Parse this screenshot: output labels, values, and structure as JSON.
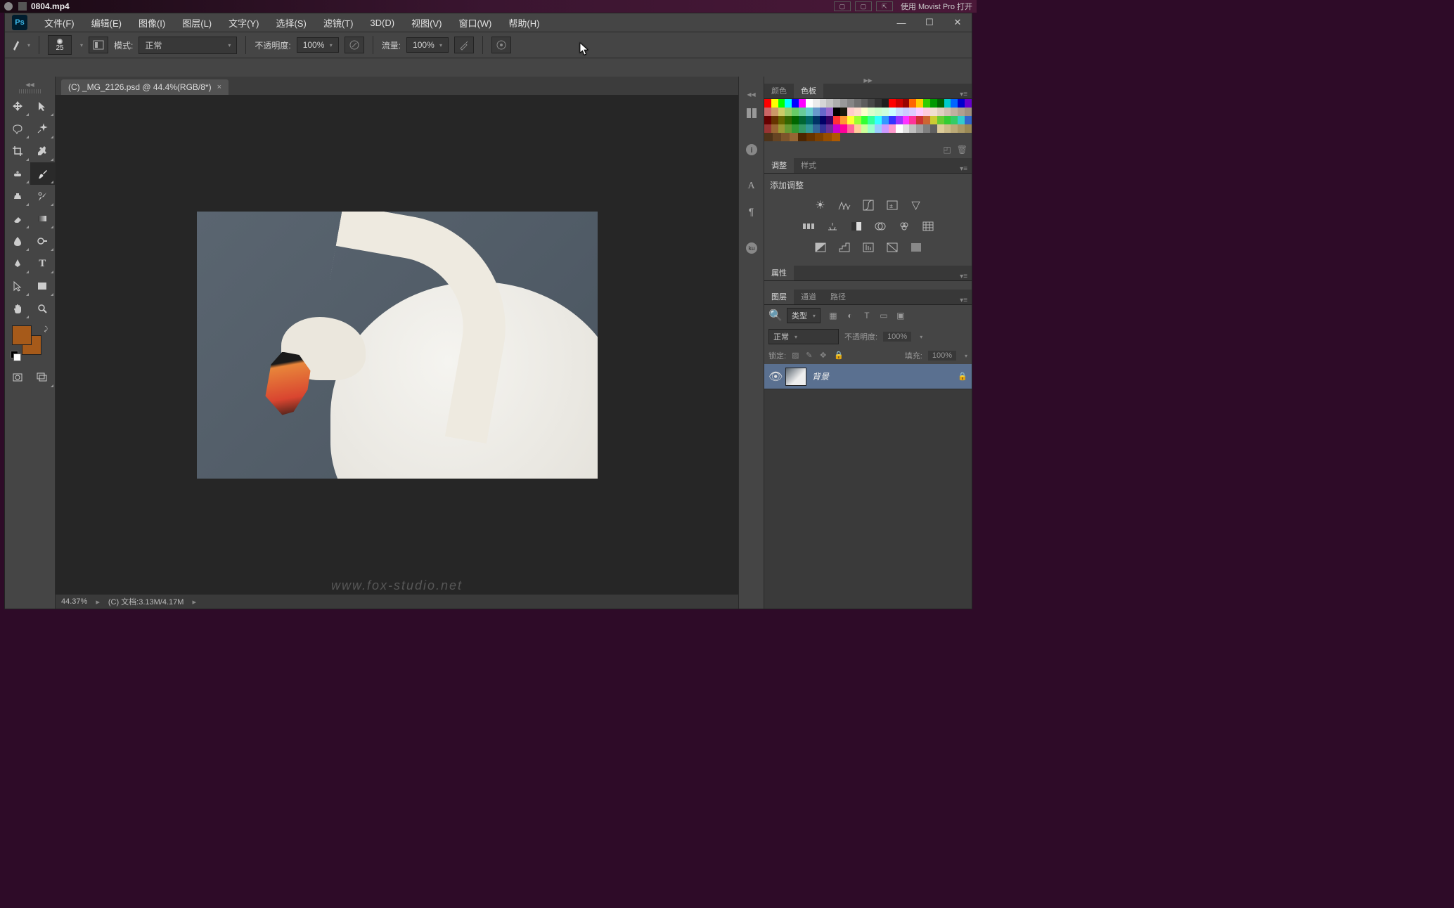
{
  "os": {
    "filename": "0804.mp4",
    "movist": "使用 Movist Pro 打开"
  },
  "window": {
    "logo": "Ps"
  },
  "menus": [
    "文件(F)",
    "编辑(E)",
    "图像(I)",
    "图层(L)",
    "文字(Y)",
    "选择(S)",
    "滤镜(T)",
    "3D(D)",
    "视图(V)",
    "窗口(W)",
    "帮助(H)"
  ],
  "options": {
    "brush_size": "25",
    "mode_label": "模式:",
    "mode_value": "正常",
    "opacity_label": "不透明度:",
    "opacity_value": "100%",
    "flow_label": "流量:",
    "flow_value": "100%"
  },
  "doc": {
    "tab": "(C) _MG_2126.psd @ 44.4%(RGB/8*)",
    "zoom": "44.37%",
    "docinfo": "(C) 文档:3.13M/4.17M",
    "watermark": "www.fox-studio.net"
  },
  "colors": {
    "fg": "#a65a1a",
    "bg": "#a65a1a"
  },
  "panels": {
    "color_tab": "颜色",
    "swatches_tab": "色板",
    "adjust_tab": "调整",
    "styles_tab": "样式",
    "adjust_title": "添加调整",
    "properties_tab": "属性",
    "layers_tab": "图层",
    "channels_tab": "通道",
    "paths_tab": "路径"
  },
  "layers": {
    "filter_label": "类型",
    "blend_mode": "正常",
    "opacity_label": "不透明度:",
    "opacity_value": "100%",
    "lock_label": "锁定:",
    "fill_label": "填充:",
    "fill_value": "100%",
    "bg_layer": "背景"
  },
  "swatches": {
    "rows": [
      [
        "#ff0000",
        "#ffff00",
        "#00ff00",
        "#00ffff",
        "#0000ff",
        "#ff00ff",
        "#ffffff",
        "#ebebeb",
        "#d6d6d6",
        "#c2c2c2",
        "#adadad",
        "#999999",
        "#858585",
        "#707070",
        "#5c5c5c",
        "#474747",
        "#333333",
        "#1f1f1f",
        "#ff0000",
        "#cc0000",
        "#990000",
        "#ff6600",
        "#ffcc00",
        "#33cc00",
        "#009900",
        "#006600",
        "#00cccc",
        "#0066ff",
        "#0000cc",
        "#6600cc"
      ],
      [
        "#cc6666",
        "#cc9966",
        "#cccc66",
        "#99cc66",
        "#66cc66",
        "#66cc99",
        "#66cccc",
        "#6699cc",
        "#6666cc",
        "#9966cc",
        "#000000",
        "#1a1a0d",
        "#ffcccc",
        "#ffddcc",
        "#ffffcc",
        "#ddffcc",
        "#ccffcc",
        "#ccffdd",
        "#ccffff",
        "#ccddff",
        "#ccccff",
        "#ddccff",
        "#ffccff",
        "#ffccdd",
        "#f0e0d0",
        "#e0d0c0",
        "#d0c0b0",
        "#c0b0a0",
        "#b0a090",
        "#a09080"
      ],
      [
        "#660000",
        "#663300",
        "#666600",
        "#336600",
        "#006600",
        "#006633",
        "#006666",
        "#003366",
        "#000066",
        "#330066",
        "#ff3333",
        "#ff9933",
        "#ffff33",
        "#99ff33",
        "#33ff33",
        "#33ff99",
        "#33ffff",
        "#3399ff",
        "#3333ff",
        "#9933ff",
        "#ff33ff",
        "#ff3399",
        "#cc3333",
        "#cc6633",
        "#cccc33",
        "#66cc33",
        "#33cc33",
        "#33cc66",
        "#33cccc",
        "#3366cc"
      ],
      [
        "#993333",
        "#996633",
        "#999933",
        "#669933",
        "#339933",
        "#339966",
        "#339999",
        "#336699",
        "#333399",
        "#663399",
        "#cc00cc",
        "#ff0099",
        "#ff6699",
        "#ffcc99",
        "#ccff99",
        "#99ffcc",
        "#99ccff",
        "#cc99ff",
        "#ff99cc",
        "#ffffff",
        "#e0e0e0",
        "#c0c0c0",
        "#a0a0a0",
        "#808080",
        "#606060",
        "#ddcc99",
        "#ccbb88",
        "#bbaa77",
        "#aa9966",
        "#998855"
      ],
      [
        "#4d3319",
        "#664422",
        "#7d552b",
        "#966633",
        "#4d2600",
        "#663300",
        "#7d4000",
        "#964d00",
        "#af5a00"
      ]
    ]
  }
}
